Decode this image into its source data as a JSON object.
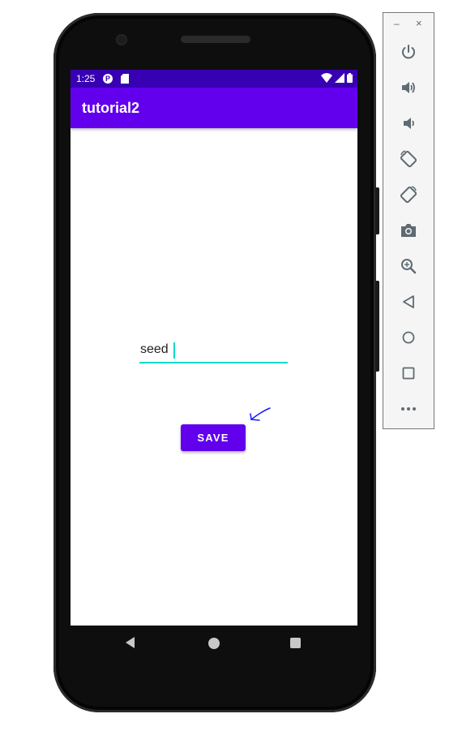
{
  "status_bar": {
    "time": "1:25",
    "p_glyph": "P"
  },
  "app": {
    "title": "tutorial2"
  },
  "form": {
    "input_value": "seed",
    "save_label": "SAVE"
  },
  "toolbar": {
    "minimize": "–",
    "close": "×"
  },
  "icons": [
    "power-icon",
    "volume-up-icon",
    "volume-down-icon",
    "rotate-left-icon",
    "rotate-right-icon",
    "camera-icon",
    "zoom-icon",
    "back-icon",
    "home-icon",
    "overview-icon",
    "more-icon"
  ],
  "colors": {
    "primary": "#6200ee",
    "primary_dark": "#3700b3",
    "accent": "#03dac5",
    "toolbar_icon": "#5f6b72"
  }
}
